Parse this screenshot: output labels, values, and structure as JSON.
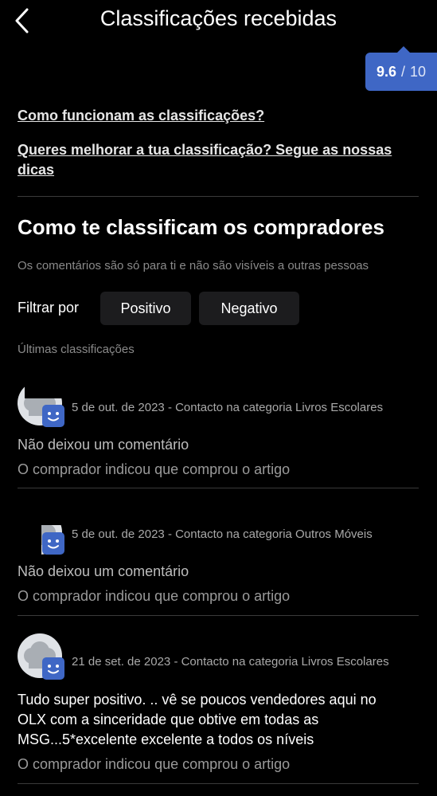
{
  "header": {
    "title": "Classificações recebidas"
  },
  "score": {
    "value": "9.6",
    "separator": "/",
    "max": "10"
  },
  "links": {
    "how_it_works": "Como funcionam as classificações?",
    "improve_line1": "Queres melhorar a tua classificação? Segue as nossas",
    "improve_line2": "dicas"
  },
  "section": {
    "title": "Como te classificam os compradores",
    "note": "Os comentários são só para ti e não são visíveis a outras pessoas"
  },
  "filter": {
    "label": "Filtrar por",
    "options": [
      "Positivo",
      "Negativo"
    ]
  },
  "latest_label": "Últimas classificações",
  "reviews": [
    {
      "meta": "5 de out. de 2023 - Contacto na categoria Livros Escolares",
      "comment": "Não deixou um comentário",
      "purchased": "O comprador indicou que comprou o artigo"
    },
    {
      "meta": "5 de out. de 2023 - Contacto na categoria Outros Móveis",
      "comment": "Não deixou um comentário",
      "purchased": "O comprador indicou que comprou o artigo"
    },
    {
      "meta": "21 de set. de 2023 - Contacto na categoria Livros Escolares",
      "comment_lines": [
        "Tudo super positivo. .. vê se poucos vendedores aqui no",
        "OLX com a sinceridade que obtive em todas as",
        "MSG...5*excelente excelente a todos os níveis"
      ],
      "purchased": "O comprador indicou que comprou o artigo"
    }
  ],
  "colors": {
    "background": "#000000",
    "accent": "#3f67c5",
    "chip": "#1c1c1e"
  }
}
